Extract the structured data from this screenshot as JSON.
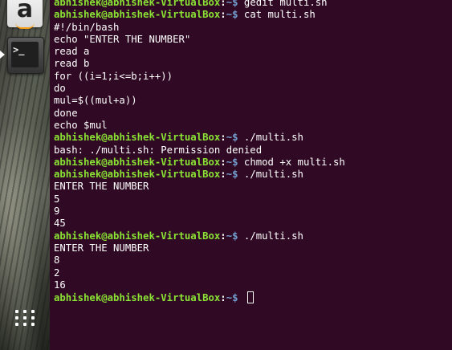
{
  "launcher": {
    "items": [
      {
        "name": "amazon-icon",
        "glyph": "a"
      },
      {
        "name": "terminal-icon",
        "glyph": ">_"
      },
      {
        "name": "show-applications-icon"
      }
    ]
  },
  "terminal": {
    "prompt_user": "abhishek@abhishek-VirtualBox",
    "prompt_sep": ":",
    "prompt_path": "~$",
    "lines": [
      {
        "type": "prompt",
        "cmd": " gedit multi.sh"
      },
      {
        "type": "prompt",
        "cmd": " cat multi.sh"
      },
      {
        "type": "out",
        "text": "#!/bin/bash"
      },
      {
        "type": "out",
        "text": "echo \"ENTER THE NUMBER\""
      },
      {
        "type": "out",
        "text": "read a"
      },
      {
        "type": "out",
        "text": "read b"
      },
      {
        "type": "out",
        "text": "for ((i=1;i<=b;i++))"
      },
      {
        "type": "out",
        "text": "do"
      },
      {
        "type": "out",
        "text": "mul=$((mul+a))"
      },
      {
        "type": "out",
        "text": "done"
      },
      {
        "type": "out",
        "text": "echo $mul"
      },
      {
        "type": "prompt",
        "cmd": " ./multi.sh"
      },
      {
        "type": "out",
        "text": "bash: ./multi.sh: Permission denied"
      },
      {
        "type": "prompt",
        "cmd": " chmod +x multi.sh"
      },
      {
        "type": "prompt",
        "cmd": " ./multi.sh"
      },
      {
        "type": "out",
        "text": "ENTER THE NUMBER"
      },
      {
        "type": "out",
        "text": "5"
      },
      {
        "type": "out",
        "text": "9"
      },
      {
        "type": "out",
        "text": "45"
      },
      {
        "type": "prompt",
        "cmd": " ./multi.sh"
      },
      {
        "type": "out",
        "text": "ENTER THE NUMBER"
      },
      {
        "type": "out",
        "text": "8"
      },
      {
        "type": "out",
        "text": "2"
      },
      {
        "type": "out",
        "text": "16"
      },
      {
        "type": "prompt",
        "cmd": " ",
        "cursor": true
      }
    ]
  },
  "colors": {
    "terminal_bg": "#300a24",
    "prompt_user": "#8ae234",
    "prompt_path": "#729fcf",
    "text": "#ffffff"
  }
}
